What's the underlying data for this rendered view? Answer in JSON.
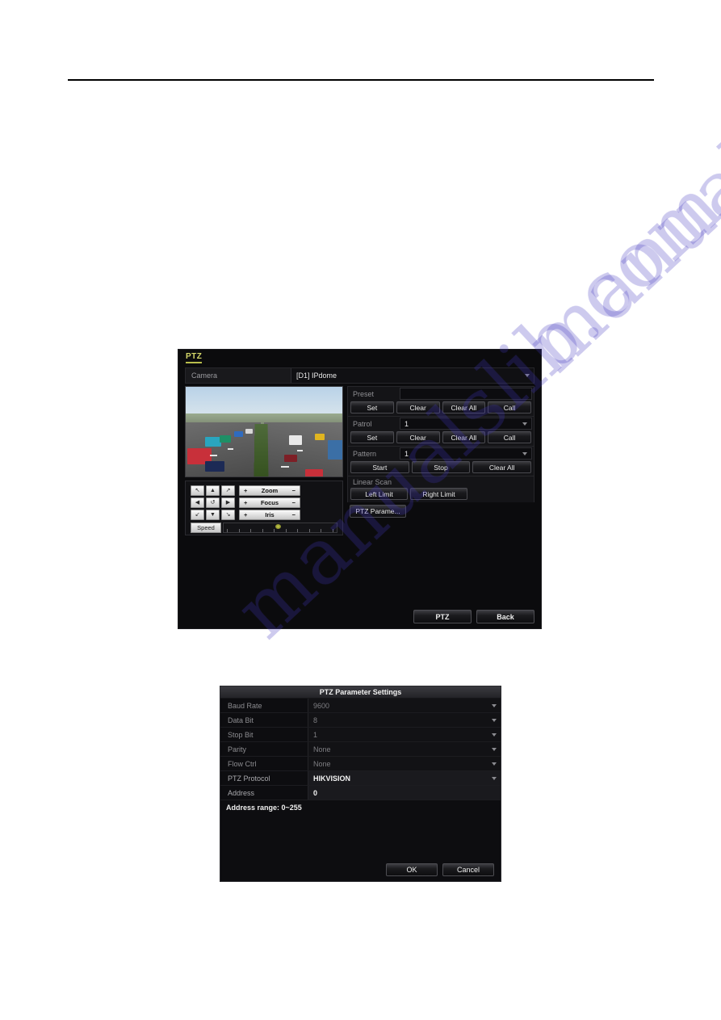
{
  "document": {
    "background_color": "#ffffff",
    "rule_color": "#000000"
  },
  "watermark": {
    "text": "manualslib.com",
    "color": "#3c32be"
  },
  "ptz_window": {
    "title": "PTZ",
    "title_color": "#d6d96a",
    "camera": {
      "label": "Camera",
      "value": "[D1] IPdome"
    },
    "preset": {
      "label": "Preset",
      "value": "",
      "buttons": [
        "Set",
        "Clear",
        "Clear All",
        "Call"
      ]
    },
    "patrol": {
      "label": "Patrol",
      "value": "1",
      "buttons": [
        "Set",
        "Clear",
        "Clear All",
        "Call"
      ]
    },
    "pattern": {
      "label": "Pattern",
      "value": "1",
      "buttons": [
        "Start",
        "Stop",
        "Clear All"
      ]
    },
    "linear_scan": {
      "label": "Linear Scan",
      "buttons": [
        "Left Limit",
        "Right Limit"
      ]
    },
    "ptz_parameter_button": "PTZ Parame...",
    "pad": {
      "directions": [
        "↖",
        "▲",
        "↗",
        "◀",
        "↺",
        "▶",
        "↙",
        "▼",
        "↘"
      ],
      "lens": [
        {
          "label": "Zoom",
          "plus": "+",
          "minus": "−"
        },
        {
          "label": "Focus",
          "plus": "+",
          "minus": "−"
        },
        {
          "label": "Iris",
          "plus": "+",
          "minus": "−"
        }
      ],
      "speed_label": "Speed",
      "speed_value": 46
    },
    "footer": {
      "ptz": "PTZ",
      "back": "Back"
    }
  },
  "param_dialog": {
    "title": "PTZ Parameter Settings",
    "rows": [
      {
        "name": "Baud Rate",
        "value": "9600",
        "active": false,
        "dropdown": true
      },
      {
        "name": "Data Bit",
        "value": "8",
        "active": false,
        "dropdown": true
      },
      {
        "name": "Stop Bit",
        "value": "1",
        "active": false,
        "dropdown": true
      },
      {
        "name": "Parity",
        "value": "None",
        "active": false,
        "dropdown": true
      },
      {
        "name": "Flow Ctrl",
        "value": "None",
        "active": false,
        "dropdown": true
      },
      {
        "name": "PTZ Protocol",
        "value": "HIKVISION",
        "active": true,
        "dropdown": true
      },
      {
        "name": "Address",
        "value": "0",
        "active": true,
        "dropdown": false
      }
    ],
    "note": "Address range: 0~255",
    "footer": {
      "ok": "OK",
      "cancel": "Cancel"
    }
  }
}
